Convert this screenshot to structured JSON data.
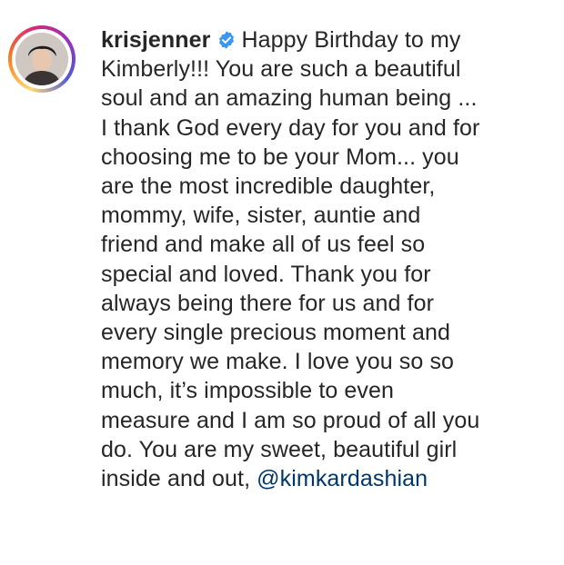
{
  "post": {
    "username": "krisjenner",
    "verified_icon": "verified-badge-icon",
    "avatar_icon": "profile-avatar",
    "accent_color": "#3897f0",
    "mention_color": "#00376b",
    "caption_first_line": "Happy Birthday to my",
    "caption_lines": [
      "Kimberly!!! You are such a beautiful",
      "soul and an amazing human being ...",
      "I thank God every day for you and for",
      "choosing me to be your Mom... you",
      "are the most incredible daughter,",
      "mommy, wife, sister, auntie and",
      "friend and make all of us feel so",
      "special and loved. Thank you for",
      "always being there for us and for",
      "every single precious moment and",
      "memory we make. I love you so so",
      "much, it’s impossible to even",
      "measure and I am so proud of all you",
      "do. You are my sweet, beautiful girl"
    ],
    "caption_last_line": "inside and out,",
    "mention": "@kimkardashian"
  }
}
